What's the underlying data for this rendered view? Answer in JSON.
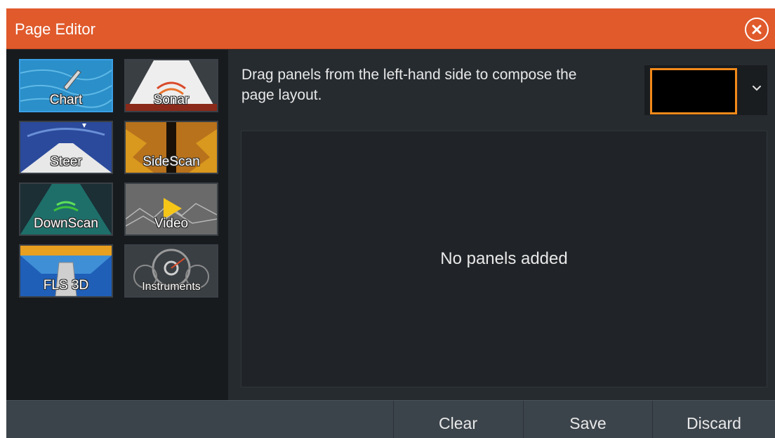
{
  "window": {
    "title": "Page Editor"
  },
  "panels": [
    {
      "id": "chart",
      "label": "Chart",
      "selected": true
    },
    {
      "id": "sonar",
      "label": "Sonar",
      "selected": false
    },
    {
      "id": "steer",
      "label": "Steer",
      "selected": false
    },
    {
      "id": "sidescan",
      "label": "SideScan",
      "selected": false
    },
    {
      "id": "downscan",
      "label": "DownScan",
      "selected": false
    },
    {
      "id": "video",
      "label": "Video",
      "selected": false
    },
    {
      "id": "fls3d",
      "label": "FLS 3D",
      "selected": false
    },
    {
      "id": "instruments",
      "label": "Instruments",
      "selected": false
    }
  ],
  "main": {
    "instruction": "Drag panels from the left-hand side to compose the page layout.",
    "empty_message": "No panels added"
  },
  "footer": {
    "clear_label": "Clear",
    "save_label": "Save",
    "discard_label": "Discard"
  },
  "colors": {
    "title_bar": "#e05a2c",
    "selection": "#3aa0e6",
    "layout_highlight": "#f28a1a"
  }
}
